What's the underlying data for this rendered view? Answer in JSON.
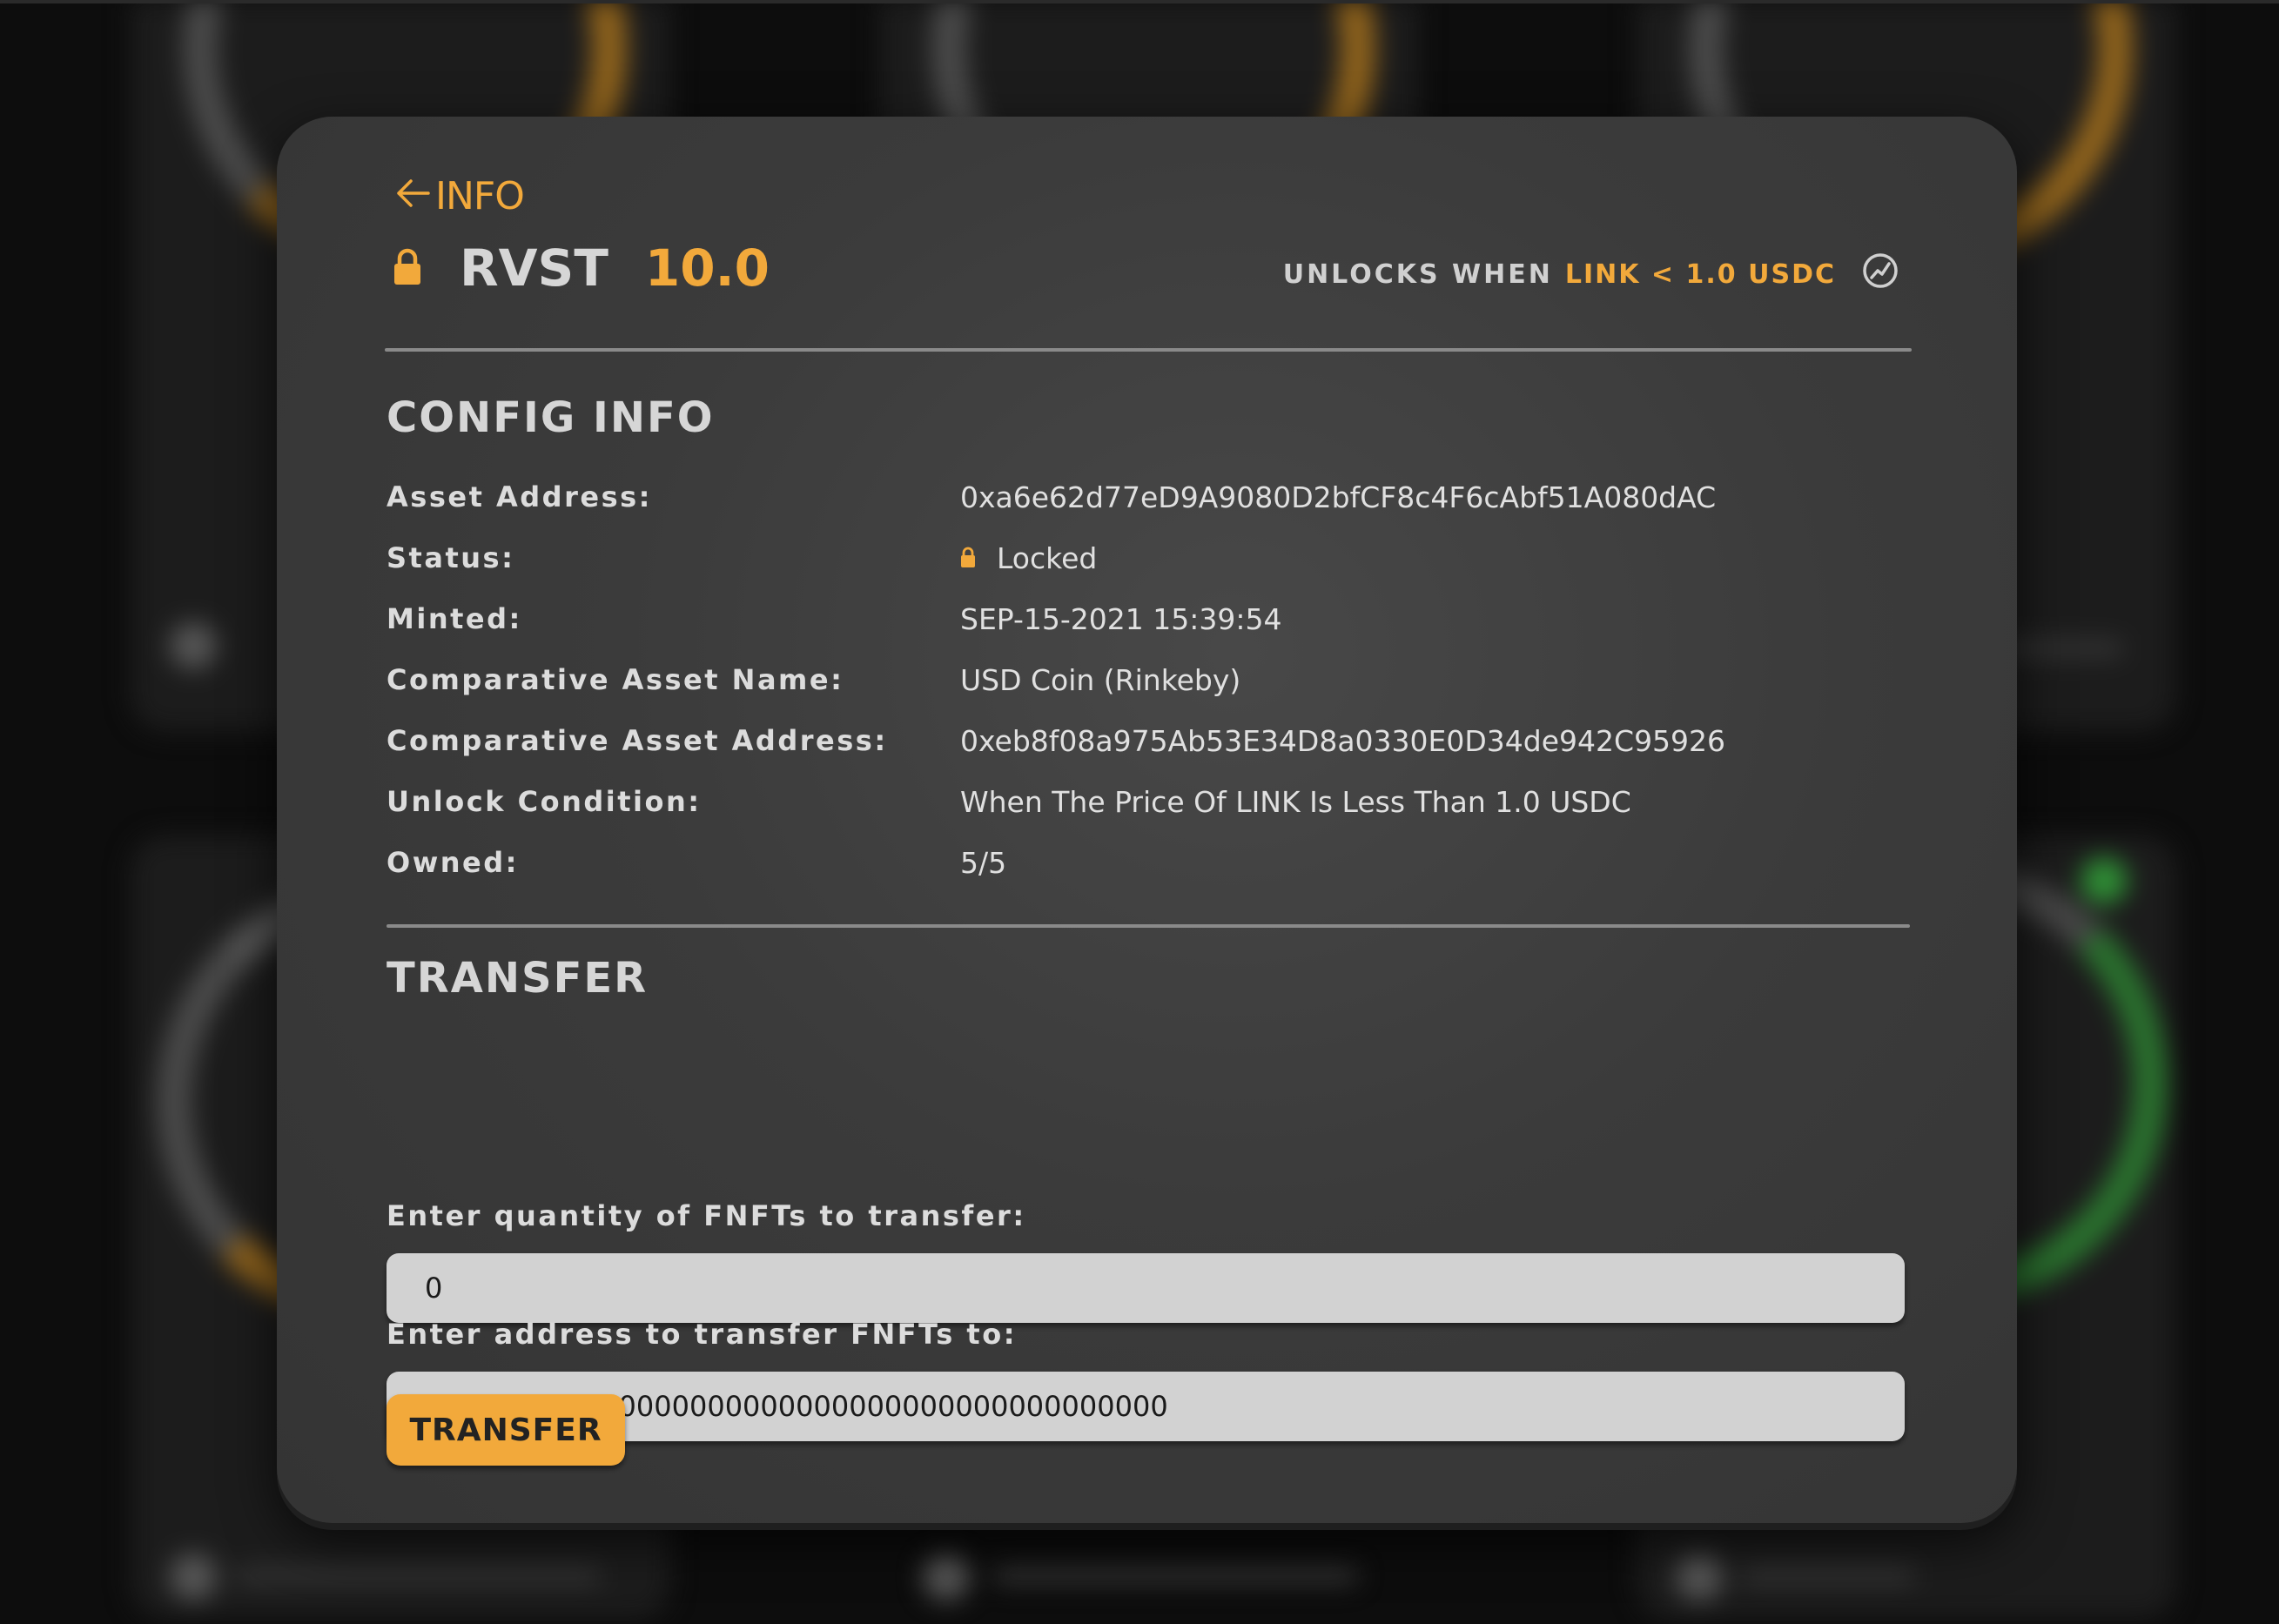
{
  "header": {
    "back_label": "INFO",
    "token_name": "RVST",
    "token_amount": "10.0",
    "unlock_label": "UNLOCKS WHEN",
    "unlock_condition": "LINK < 1.0 USDC"
  },
  "config": {
    "title": "CONFIG INFO",
    "rows": [
      {
        "label": "Asset Address:",
        "value": "0xa6e62d77eD9A9080D2bfCF8c4F6cAbf51A080dAC"
      },
      {
        "label": "Status:",
        "value": "Locked"
      },
      {
        "label": "Minted:",
        "value": "SEP-15-2021 15:39:54"
      },
      {
        "label": "Comparative Asset Name:",
        "value": "USD Coin (Rinkeby)"
      },
      {
        "label": "Comparative Asset Address:",
        "value": "0xeb8f08a975Ab53E34D8a0330E0D34de942C95926"
      },
      {
        "label": "Unlock Condition:",
        "value": "When The Price Of LINK Is Less Than 1.0 USDC"
      },
      {
        "label": "Owned:",
        "value": "5/5"
      }
    ]
  },
  "transfer": {
    "title": "TRANSFER",
    "quantity_label": "Enter quantity of FNFTs to transfer:",
    "quantity_value": "0",
    "address_label": "Enter address to transfer FNFTs to:",
    "address_value": "0x0000000000000000000000000000000000000000",
    "button_label": "TRANSFER"
  },
  "colors": {
    "accent": "#f2a93b",
    "modal_bg": "#3b3b3b",
    "text": "#d6d6d6",
    "field_bg": "#d2d2d2"
  },
  "icons": {
    "back": "arrow-left-icon",
    "lock": "lock-icon",
    "chart": "chart-circle-icon"
  }
}
